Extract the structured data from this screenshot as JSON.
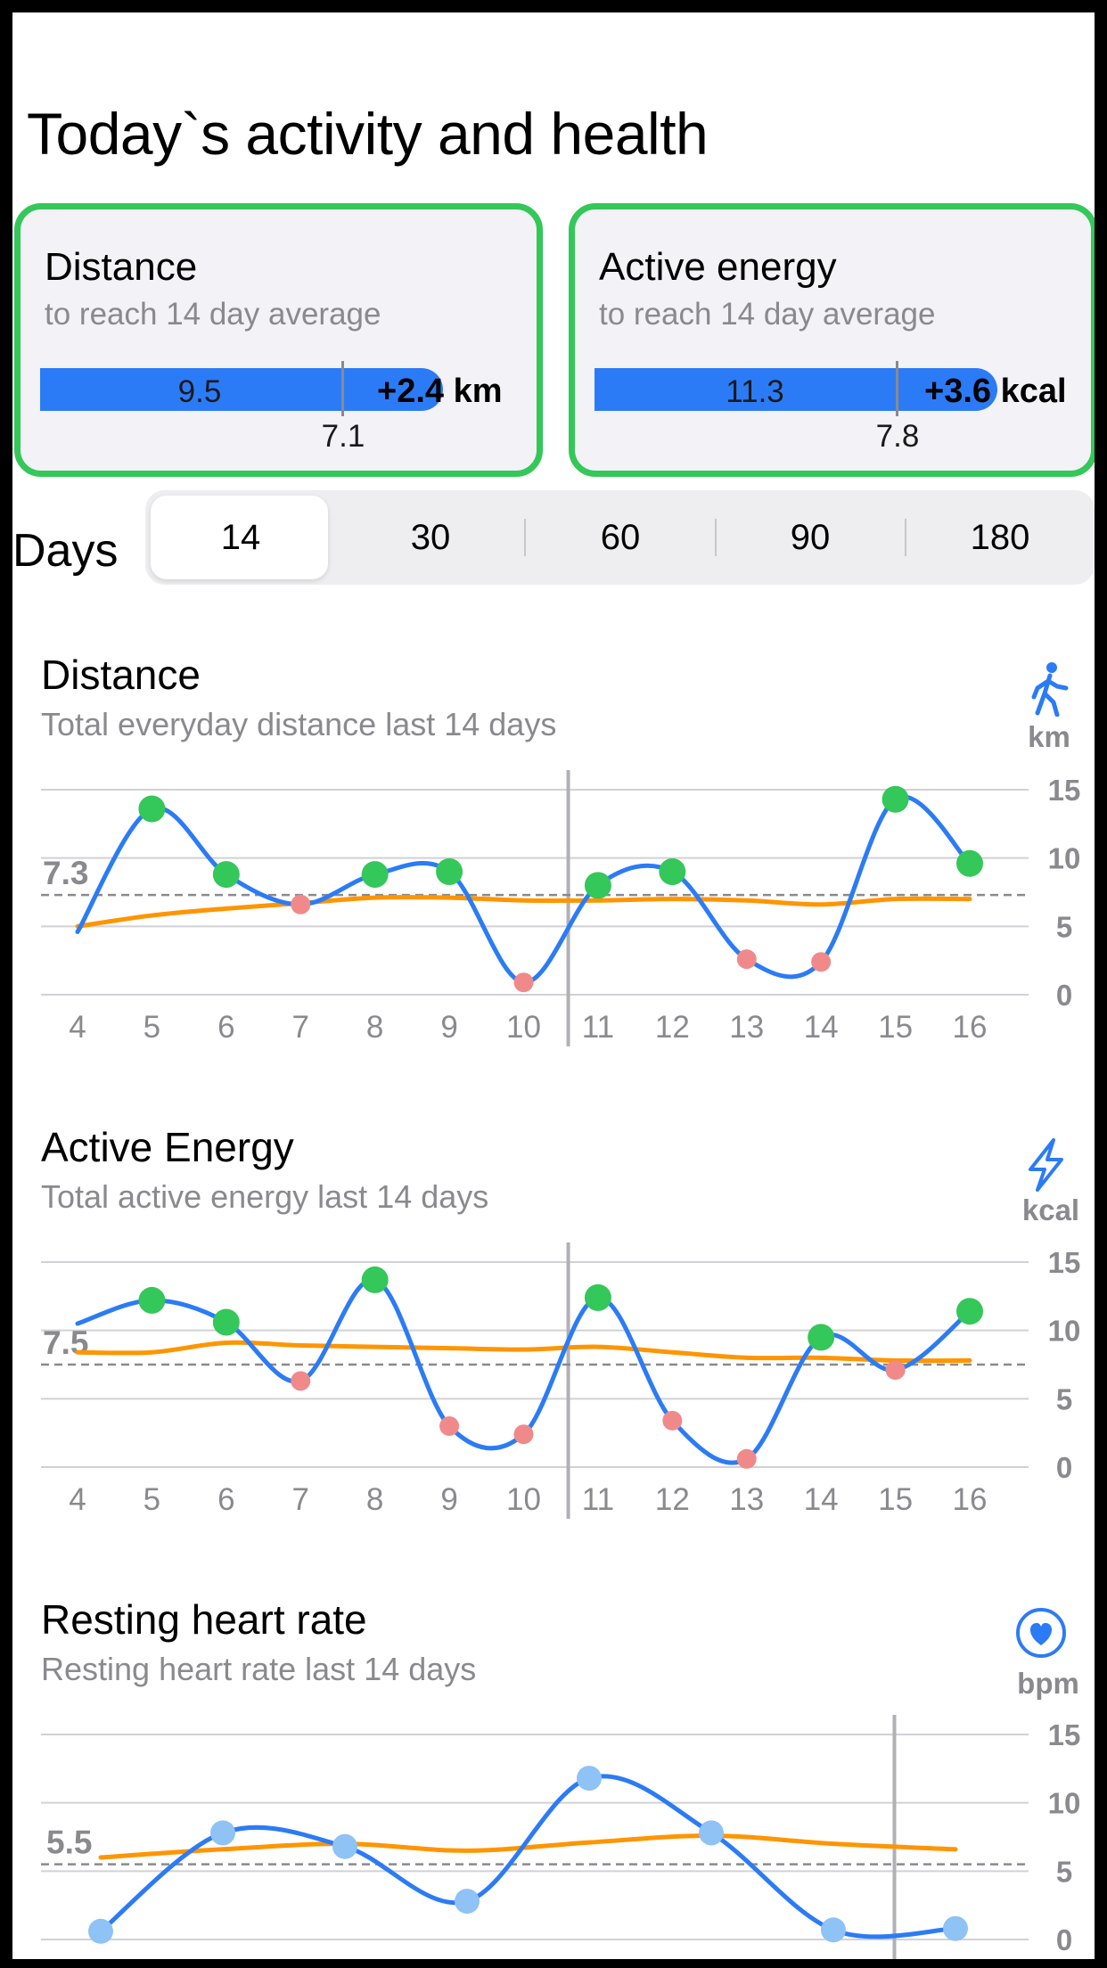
{
  "title": "Today`s activity and health",
  "cards": [
    {
      "title": "Distance",
      "subtitle": "to reach 14 day average",
      "bar_value": "9.5",
      "delta": "+2.4 km",
      "average": "7.1"
    },
    {
      "title": "Active energy",
      "subtitle": "to reach 14 day average",
      "bar_value": "11.3",
      "delta": "+3.6 kcal",
      "average": "7.8"
    }
  ],
  "days": {
    "label": "Days",
    "options": [
      "14",
      "30",
      "60",
      "90",
      "180"
    ],
    "selected": "14"
  },
  "sections": [
    {
      "title": "Distance",
      "subtitle": "Total everyday distance last 14 days",
      "unit": "km",
      "icon": "walking-figure-icon"
    },
    {
      "title": "Active Energy",
      "subtitle": "Total active energy last 14 days",
      "unit": "kcal",
      "icon": "lightning-bolt-icon"
    },
    {
      "title": "Resting heart rate",
      "subtitle": "Resting heart rate last 14 days",
      "unit": "bpm",
      "icon": "heart-icon"
    }
  ],
  "colors": {
    "accent_blue": "#2c7bf6",
    "average_orange": "#ff9500",
    "above_green": "#34c759",
    "below_red": "#f08a8a",
    "point_blue": "#8fc2f5",
    "card_border": "#34c759"
  },
  "chart_data": [
    {
      "type": "line",
      "title": "Distance",
      "x": [
        4,
        5,
        6,
        7,
        8,
        9,
        10,
        11,
        12,
        13,
        14,
        15,
        16
      ],
      "x_labels": [
        "4",
        "5",
        "6",
        "7",
        "8",
        "9",
        "10",
        "11",
        "12",
        "13",
        "14",
        "15",
        "16"
      ],
      "series": [
        {
          "values": [
            4.6,
            13.6,
            8.8,
            6.6,
            8.8,
            9.0,
            0.9,
            8.0,
            9.0,
            2.6,
            2.4,
            14.3,
            9.6
          ]
        },
        {
          "values": [
            5.0,
            5.8,
            6.3,
            6.7,
            7.1,
            7.1,
            6.9,
            6.9,
            7.0,
            6.9,
            6.6,
            7.0,
            7.0
          ]
        }
      ],
      "highlight": [
        null,
        "above",
        "above",
        "below",
        "above",
        "above",
        "below",
        "above",
        "above",
        "below",
        "below",
        "above",
        "above"
      ],
      "average_line": 7.3,
      "average_label": "7.3",
      "ylim": [
        0,
        15
      ],
      "y_ticks": [
        0,
        5,
        10,
        15
      ],
      "today_marker_x": 10.6
    },
    {
      "type": "line",
      "title": "Active Energy",
      "x": [
        4,
        5,
        6,
        7,
        8,
        9,
        10,
        11,
        12,
        13,
        14,
        15,
        16
      ],
      "x_labels": [
        "4",
        "5",
        "6",
        "7",
        "8",
        "9",
        "10",
        "11",
        "12",
        "13",
        "14",
        "15",
        "16"
      ],
      "series": [
        {
          "values": [
            10.5,
            12.2,
            10.6,
            6.3,
            13.7,
            3.0,
            2.4,
            12.4,
            3.4,
            0.6,
            9.5,
            7.1,
            11.4
          ]
        },
        {
          "values": [
            8.4,
            8.4,
            9.1,
            8.9,
            8.8,
            8.7,
            8.6,
            8.8,
            8.4,
            8.0,
            8.0,
            7.8,
            7.8
          ]
        }
      ],
      "highlight": [
        null,
        "above",
        "above",
        "below",
        "above",
        "below",
        "below",
        "above",
        "below",
        "below",
        "above",
        "below",
        "above"
      ],
      "average_line": 7.5,
      "average_label": "7.5",
      "ylim": [
        0,
        15
      ],
      "y_ticks": [
        0,
        5,
        10,
        15
      ],
      "today_marker_x": 10.6
    },
    {
      "type": "line",
      "title": "Resting heart rate",
      "x": [
        0,
        1,
        2,
        3,
        4,
        5,
        6,
        7
      ],
      "series": [
        {
          "values": [
            0.6,
            7.8,
            6.8,
            2.8,
            11.8,
            7.8,
            0.7,
            0.8
          ]
        },
        {
          "values": [
            6.0,
            6.6,
            7.0,
            6.5,
            7.1,
            7.6,
            7.0,
            6.6
          ]
        }
      ],
      "highlight": [
        "point",
        "point",
        "point",
        "point",
        "point",
        "point",
        "point",
        "point"
      ],
      "average_line": 5.5,
      "average_label": "5.5",
      "ylim": [
        0,
        15
      ],
      "y_ticks": [
        0,
        5,
        10,
        15
      ],
      "today_marker_x": 6.5
    }
  ]
}
